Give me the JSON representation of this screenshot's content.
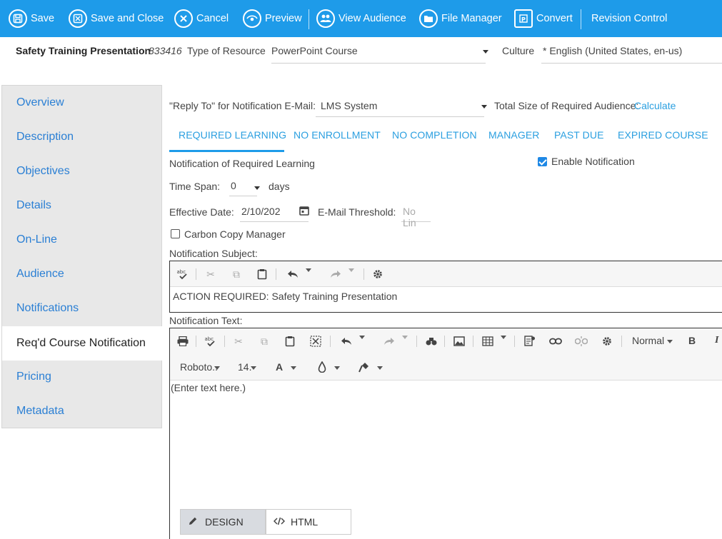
{
  "toolbar": {
    "save": "Save",
    "save_close": "Save and Close",
    "cancel": "Cancel",
    "preview": "Preview",
    "view_audience": "View Audience",
    "file_manager": "File Manager",
    "convert": "Convert",
    "revision_control": "Revision Control"
  },
  "header": {
    "title": "Safety Training Presentation",
    "course_id": "833416",
    "type_label": "Type of Resource",
    "type_value": "PowerPoint Course",
    "culture_label": "Culture",
    "culture_value": "* English (United States, en-us)"
  },
  "sidebar": {
    "items": [
      {
        "label": "Overview"
      },
      {
        "label": "Description"
      },
      {
        "label": "Objectives"
      },
      {
        "label": "Details"
      },
      {
        "label": "On-Line"
      },
      {
        "label": "Audience"
      },
      {
        "label": "Notifications"
      },
      {
        "label": "Req'd Course Notification"
      },
      {
        "label": "Pricing"
      },
      {
        "label": "Metadata"
      }
    ],
    "active": "Req'd Course Notification"
  },
  "main": {
    "reply_to_label": "\"Reply To\" for Notification E-Mail:",
    "reply_to_value": "LMS System",
    "total_size_label": "Total Size of Required Audience:",
    "calculate_link": "Calculate",
    "tabs": [
      {
        "label": "REQUIRED LEARNING"
      },
      {
        "label": "NO ENROLLMENT"
      },
      {
        "label": "NO COMPLETION"
      },
      {
        "label": "MANAGER"
      },
      {
        "label": "PAST DUE"
      },
      {
        "label": "EXPIRED COURSE"
      }
    ],
    "section_title": "Notification of Required Learning",
    "enable_notification": "Enable Notification",
    "enable_checked": true,
    "time_span_label": "Time Span:",
    "time_span_value": "0",
    "time_span_unit": "days",
    "effective_date_label": "Effective Date:",
    "effective_date_value": "2/10/202",
    "email_threshold_label": "E-Mail Threshold:",
    "email_threshold_placeholder": "No Lin",
    "cc_manager": "Carbon Copy Manager",
    "cc_checked": false,
    "subject_label": "Notification Subject:",
    "subject_value": "ACTION REQUIRED:  Safety Training Presentation",
    "text_label": "Notification Text:",
    "text_value": "(Enter text here.)",
    "format_select": "Normal",
    "font_select": "Roboto..",
    "size_select": "14.",
    "design_tab": "DESIGN",
    "html_tab": "HTML"
  },
  "colors": {
    "brand": "#1e9be9",
    "link": "#2a9fe0",
    "sidebar_bg": "#e8e8e8"
  }
}
